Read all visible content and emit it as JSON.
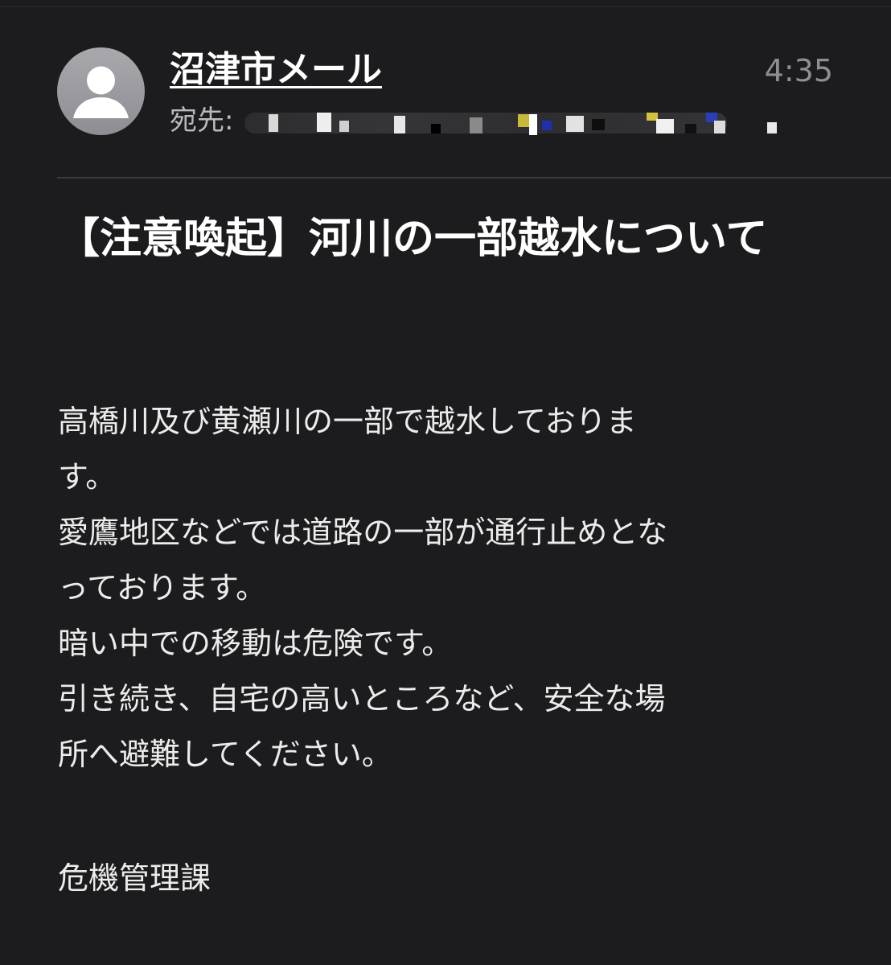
{
  "header": {
    "sender_name": "沼津市メール",
    "time": "4:35",
    "to_label": "宛先:"
  },
  "message": {
    "subject": "【注意喚起】河川の一部越水について",
    "body_lines": [
      "高橋川及び黄瀬川の一部で越水しておりま",
      "す。",
      "愛鷹地区などでは道路の一部が通行止めとな",
      "っております。",
      "暗い中での移動は危険です。",
      "引き続き、自宅の高いところなど、安全な場",
      "所へ避難してください。"
    ],
    "signature": "危機管理課"
  },
  "icons": {
    "avatar": "person-silhouette-icon"
  },
  "colors": {
    "background": "#1c1c1e",
    "divider": "#3a3a3c",
    "secondary_text": "#8e8e93"
  }
}
